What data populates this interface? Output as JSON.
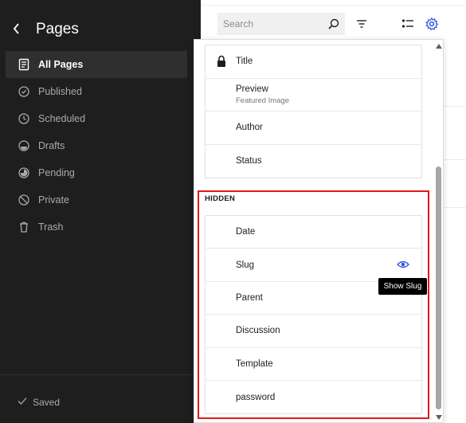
{
  "sidebar": {
    "title": "Pages",
    "items": [
      {
        "label": "All Pages",
        "icon": "pages-icon",
        "active": true
      },
      {
        "label": "Published",
        "icon": "published-icon"
      },
      {
        "label": "Scheduled",
        "icon": "scheduled-icon"
      },
      {
        "label": "Drafts",
        "icon": "drafts-icon"
      },
      {
        "label": "Pending",
        "icon": "pending-icon"
      },
      {
        "label": "Private",
        "icon": "private-icon"
      },
      {
        "label": "Trash",
        "icon": "trash-icon"
      }
    ],
    "footer_status": "Saved"
  },
  "toolbar": {
    "search_placeholder": "Search"
  },
  "popover": {
    "visible_fields": [
      {
        "label": "Title",
        "locked": true
      },
      {
        "label": "Preview",
        "sublabel": "Featured Image"
      },
      {
        "label": "Author"
      },
      {
        "label": "Status"
      }
    ],
    "hidden_heading": "HIDDEN",
    "hidden_fields": [
      {
        "label": "Date"
      },
      {
        "label": "Slug"
      },
      {
        "label": "Parent"
      },
      {
        "label": "Discussion"
      },
      {
        "label": "Template"
      },
      {
        "label": "password"
      }
    ],
    "tooltip": "Show Slug"
  },
  "colors": {
    "accent": "#3858e9",
    "highlight": "#e01919",
    "sidebar_bg": "#1e1e1e"
  }
}
